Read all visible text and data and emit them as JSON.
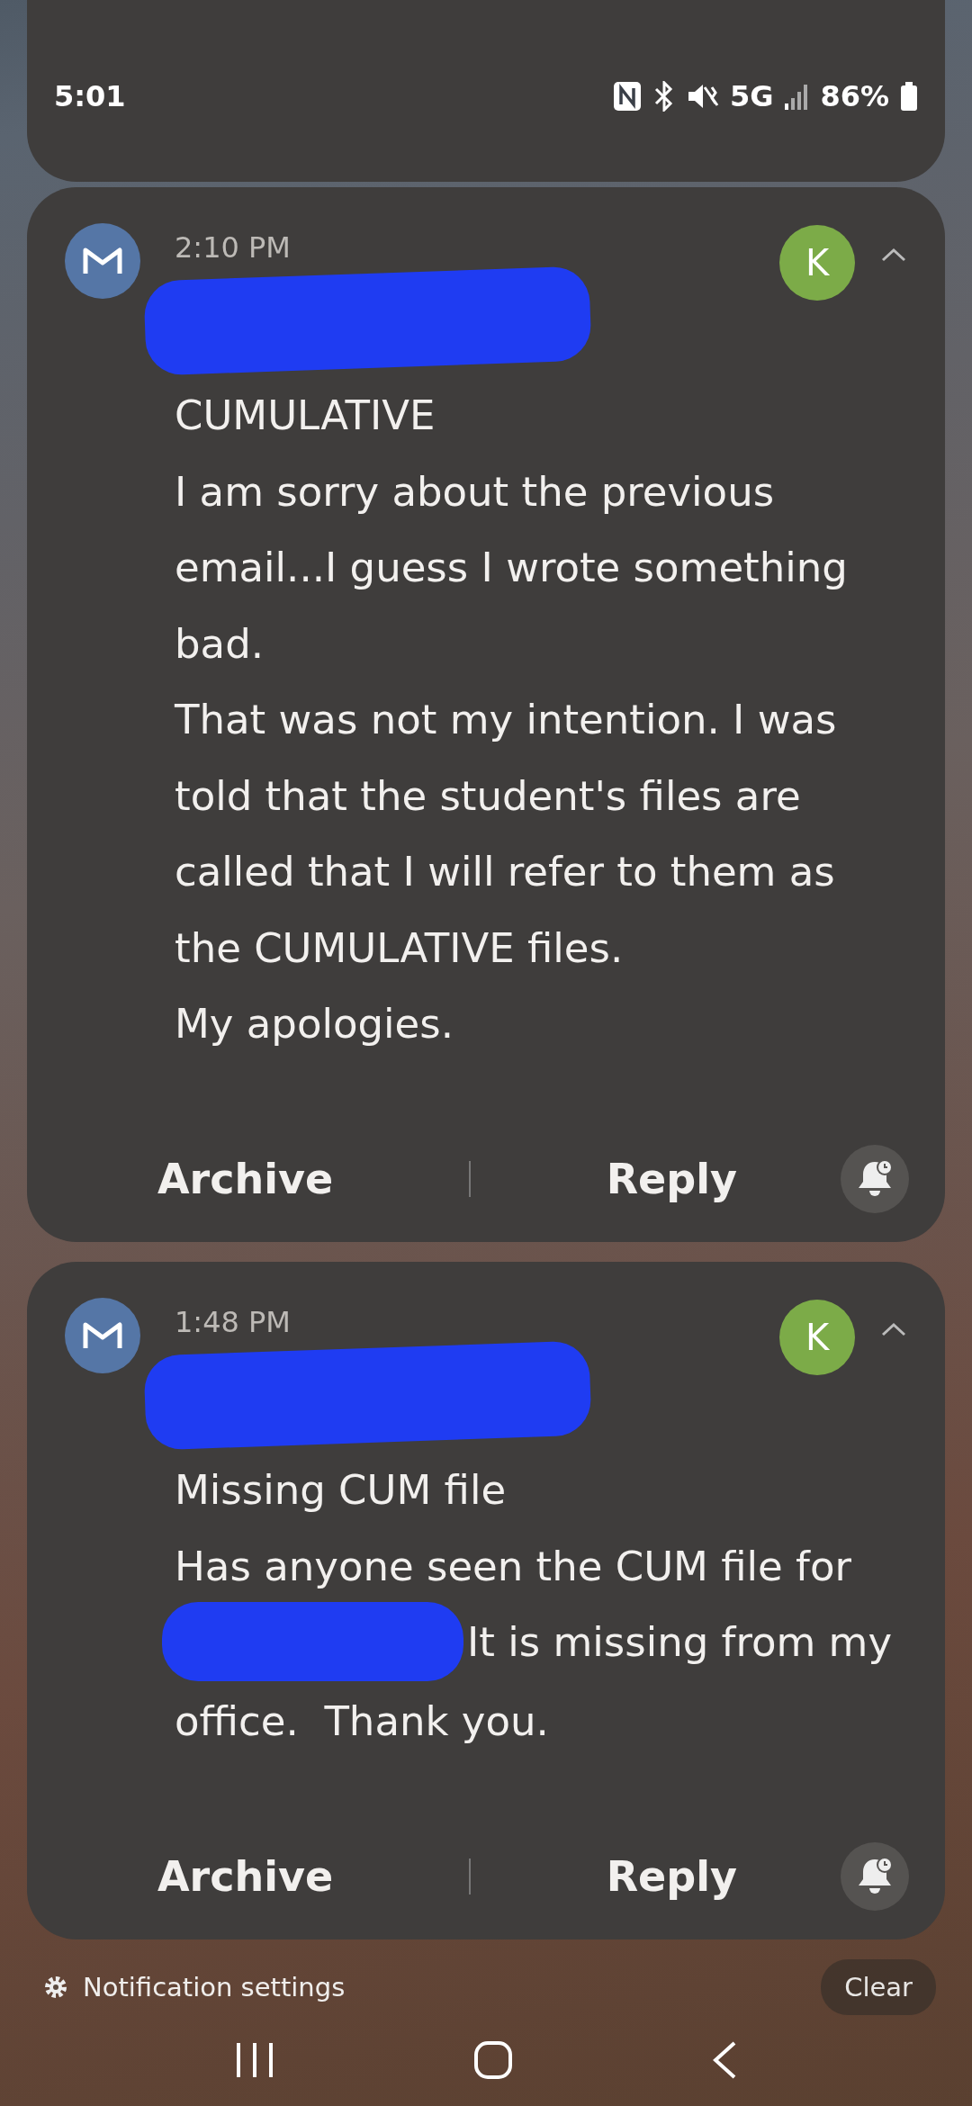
{
  "status_bar": {
    "time": "5:01",
    "network": "5G",
    "battery": "86%"
  },
  "notifications": [
    {
      "time": "2:10 PM",
      "avatar": "K",
      "expanded": true,
      "subject": "CUMULATIVE",
      "body_lines": [
        {
          "text": "I am sorry about the previous",
          "redacted_before": false
        },
        {
          "text": "email...I guess I wrote something",
          "redacted_before": false
        },
        {
          "text": "bad.",
          "redacted_before": false
        },
        {
          "text": "That was not my intention. I was",
          "redacted_before": false
        },
        {
          "text": "told that the student's files are",
          "redacted_before": false
        },
        {
          "text": "called that I will refer to them as",
          "redacted_before": false
        },
        {
          "text": "the CUMULATIVE files.",
          "redacted_before": false
        },
        {
          "text": "My apologies.",
          "redacted_before": false
        }
      ],
      "actions": [
        "Archive",
        "Reply"
      ]
    },
    {
      "time": "1:48 PM",
      "avatar": "K",
      "expanded": true,
      "subject": "Missing CUM file",
      "body_lines": [
        {
          "text": "Has anyone seen the CUM file for",
          "redacted_before": false
        },
        {
          "text": "It is missing from my",
          "redacted_before": true
        },
        {
          "text": "office.  Thank you.",
          "redacted_before": false
        }
      ],
      "actions": [
        "Archive",
        "Reply"
      ]
    }
  ],
  "footer": {
    "settings_link": "Notification settings",
    "clear_button": "Clear"
  }
}
